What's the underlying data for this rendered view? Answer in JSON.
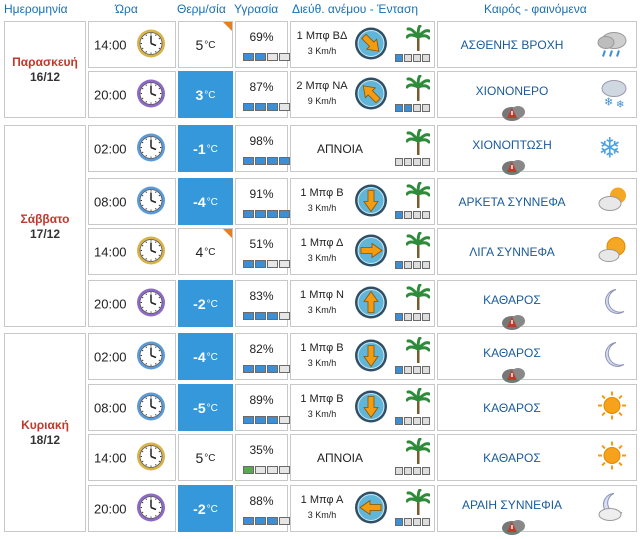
{
  "headers": {
    "date": "Ημερομηνία",
    "time": "Ώρα",
    "temp": "Θερμ/σία",
    "humidity": "Υγρασία",
    "wind": "Διεύθ. ανέμου - Ένταση",
    "weather": "Καιρός - φαινόμενα"
  },
  "days": [
    {
      "name": "Παρασκευή",
      "date": "16/12"
    },
    {
      "name": "Σάββατο",
      "date": "17/12"
    },
    {
      "name": "Κυριακή",
      "date": "18/12"
    }
  ],
  "rows": [
    {
      "time": "14:00",
      "clock": "gold",
      "temp": "5",
      "temp_style": "white",
      "corner": true,
      "humidity": "69%",
      "hum_level": 2,
      "wind_label": "1 Μπφ ΒΔ",
      "wind_speed": "3 Km/h",
      "wind_dir": "NW",
      "wind_level": 1,
      "weather": "ΑΣΘΕΝΗΣ ΒΡΟΧΗ",
      "weather_icon": "rain-cloud-icon",
      "warn": false
    },
    {
      "time": "20:00",
      "clock": "purple",
      "temp": "3",
      "temp_style": "blue",
      "corner": false,
      "humidity": "87%",
      "hum_level": 3,
      "wind_label": "2 Μπφ ΝΑ",
      "wind_speed": "9 Km/h",
      "wind_dir": "SE",
      "wind_level": 2,
      "weather": "ΧΙΟΝΟΝΕΡΟ",
      "weather_icon": "sleet-icon",
      "warn": true
    },
    {
      "time": "02:00",
      "clock": "blue",
      "temp": "-1",
      "temp_style": "blue",
      "corner": false,
      "humidity": "98%",
      "hum_level": 4,
      "wind_label": "ΑΠΝΟΙΑ",
      "wind_speed": "",
      "wind_dir": "none",
      "wind_level": 0,
      "weather": "ΧΙΟΝΟΠΤΩΣΗ",
      "weather_icon": "snowflake-icon",
      "warn": true
    },
    {
      "time": "08:00",
      "clock": "blue",
      "temp": "-4",
      "temp_style": "blue",
      "corner": false,
      "humidity": "91%",
      "hum_level": 4,
      "wind_label": "1 Μπφ Β",
      "wind_speed": "3 Km/h",
      "wind_dir": "N",
      "wind_level": 1,
      "weather": "ΑΡΚΕΤΑ ΣΥΝΝΕΦΑ",
      "weather_icon": "partly-cloudy-icon",
      "warn": false
    },
    {
      "time": "14:00",
      "clock": "gold",
      "temp": "4",
      "temp_style": "white",
      "corner": true,
      "humidity": "51%",
      "hum_level": 2,
      "wind_label": "1 Μπφ Δ",
      "wind_speed": "3 Km/h",
      "wind_dir": "W",
      "wind_level": 1,
      "weather": "ΛΙΓΑ ΣΥΝΝΕΦΑ",
      "weather_icon": "sun-cloud-icon",
      "warn": false
    },
    {
      "time": "20:00",
      "clock": "purple",
      "temp": "-2",
      "temp_style": "blue",
      "corner": false,
      "humidity": "83%",
      "hum_level": 3,
      "wind_label": "1 Μπφ Ν",
      "wind_speed": "3 Km/h",
      "wind_dir": "S",
      "wind_level": 1,
      "weather": "ΚΑΘΑΡΟΣ",
      "weather_icon": "moon-icon",
      "warn": true
    },
    {
      "time": "02:00",
      "clock": "blue",
      "temp": "-4",
      "temp_style": "blue",
      "corner": false,
      "humidity": "82%",
      "hum_level": 3,
      "wind_label": "1 Μπφ Β",
      "wind_speed": "3 Km/h",
      "wind_dir": "N",
      "wind_level": 1,
      "weather": "ΚΑΘΑΡΟΣ",
      "weather_icon": "moon-icon",
      "warn": true
    },
    {
      "time": "08:00",
      "clock": "blue",
      "temp": "-5",
      "temp_style": "blue",
      "corner": false,
      "humidity": "89%",
      "hum_level": 3,
      "wind_label": "1 Μπφ Β",
      "wind_speed": "3 Km/h",
      "wind_dir": "N",
      "wind_level": 1,
      "weather": "ΚΑΘΑΡΟΣ",
      "weather_icon": "sun-icon",
      "warn": false
    },
    {
      "time": "14:00",
      "clock": "gold",
      "temp": "5",
      "temp_style": "white",
      "corner": false,
      "humidity": "35%",
      "hum_level": 1,
      "wind_label": "ΑΠΝΟΙΑ",
      "wind_speed": "",
      "wind_dir": "none",
      "wind_level": 0,
      "weather": "ΚΑΘΑΡΟΣ",
      "weather_icon": "sun-icon",
      "warn": false
    },
    {
      "time": "20:00",
      "clock": "purple",
      "temp": "-2",
      "temp_style": "blue",
      "corner": false,
      "humidity": "88%",
      "hum_level": 3,
      "wind_label": "1 Μπφ Α",
      "wind_speed": "3 Km/h",
      "wind_dir": "E",
      "wind_level": 1,
      "weather": "ΑΡΑΙΗ ΣΥΝΝΕΦΙΑ",
      "weather_icon": "moon-cloud-icon",
      "warn": true
    }
  ],
  "unit": "°C",
  "colors": {
    "accent": "#3498db",
    "date_red": "#c0392b",
    "header_blue": "#1a6fb0",
    "weather_text": "#1a5a9a"
  }
}
